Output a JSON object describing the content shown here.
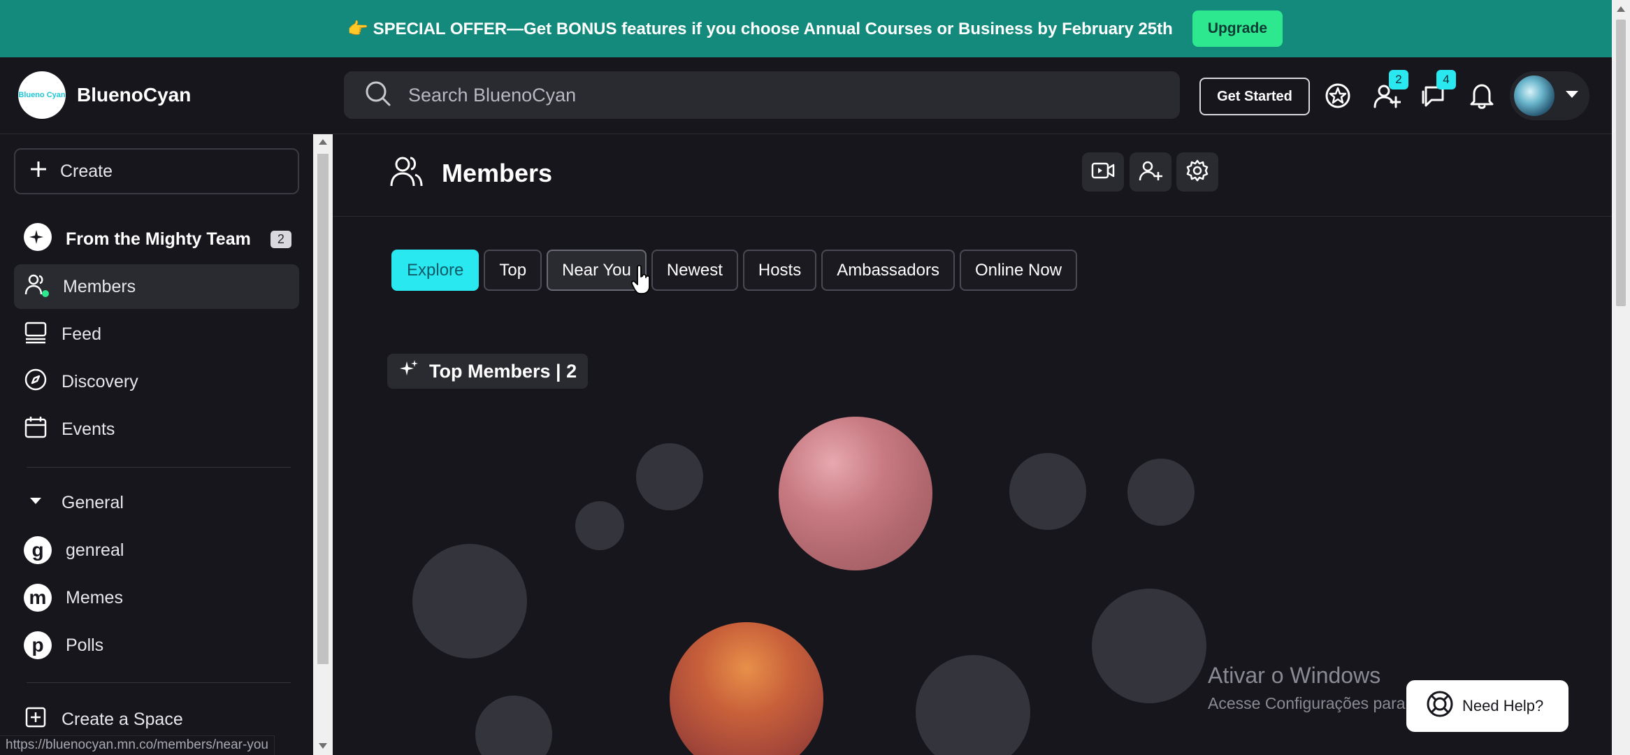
{
  "banner": {
    "emoji": "👉",
    "text": "SPECIAL OFFER—Get BONUS features if you choose Annual Courses or Business by February 25th",
    "upgrade_label": "Upgrade"
  },
  "brand": {
    "logo_text": "Blueno Cyan",
    "name": "BluenoCyan"
  },
  "search": {
    "placeholder": "Search BluenoCyan"
  },
  "topbar": {
    "get_started_label": "Get Started",
    "icons": [
      "star-badge-icon",
      "add-person-icon",
      "chat-icon",
      "bell-icon",
      "avatar",
      "chevron-down-icon"
    ],
    "add_person_badge": "2",
    "chat_badge": "4"
  },
  "sidebar": {
    "create_label": "Create",
    "mighty_team": {
      "label": "From the Mighty Team",
      "count": "2"
    },
    "nav": [
      {
        "label": "Members",
        "icon": "members-icon"
      },
      {
        "label": "Feed",
        "icon": "feed-icon"
      },
      {
        "label": "Discovery",
        "icon": "compass-icon"
      },
      {
        "label": "Events",
        "icon": "calendar-icon"
      }
    ],
    "section_label": "General",
    "spaces": [
      {
        "letter": "g",
        "label": "genreal"
      },
      {
        "letter": "m",
        "label": "Memes"
      },
      {
        "letter": "p",
        "label": "Polls"
      }
    ],
    "create_space_label": "Create a Space"
  },
  "status_url": "https://bluenocyan.mn.co/members/near-you",
  "main": {
    "title": "Members",
    "header_icons": [
      "video-icon",
      "add-member-icon",
      "settings-icon"
    ],
    "tabs": [
      "Explore",
      "Top",
      "Near You",
      "Newest",
      "Hosts",
      "Ambassadors",
      "Online Now"
    ],
    "active_tab": "Explore",
    "section_title": "Top Members | 2"
  },
  "watermark": {
    "title": "Ativar o Windows",
    "subtitle": "Acesse Configurações para ativar o Windows."
  },
  "help": {
    "label": "Need Help?"
  },
  "colors": {
    "banner": "#148a7c",
    "upgrade": "#2ee88f",
    "accent": "#2ae8f0",
    "background": "#16161c"
  }
}
